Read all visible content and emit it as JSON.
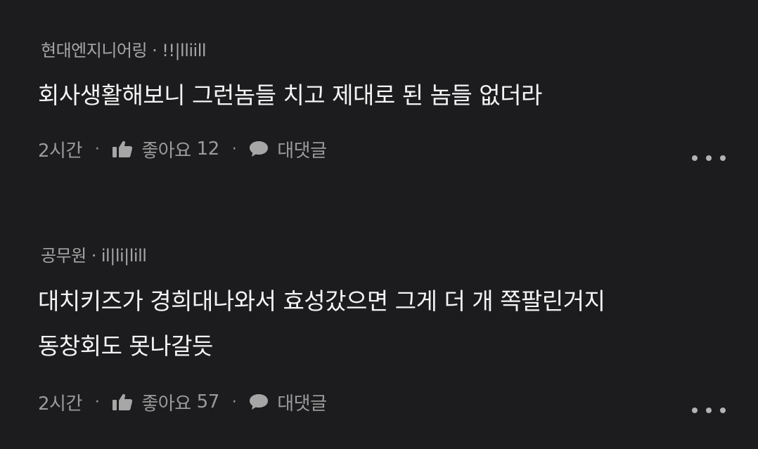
{
  "comments": [
    {
      "company": "현대엔지니어링",
      "separator": "·",
      "username": "!!|lliill",
      "text_lines": [
        "회사생활해보니 그런놈들 치고 제대로 된 놈들 없더라"
      ],
      "time": "2시간",
      "like_label": "좋아요",
      "like_count": "12",
      "reply_label": "대댓글"
    },
    {
      "company": "공무원",
      "separator": "·",
      "username": "il|li|lill",
      "text_lines": [
        "대치키즈가 경희대나와서 효성갔으면 그게 더 개 쪽팔린거지",
        "동창회도 못나갈듯"
      ],
      "time": "2시간",
      "like_label": "좋아요",
      "like_count": "57",
      "reply_label": "대댓글"
    }
  ],
  "icons": {
    "like": "thumbs-up-icon",
    "reply": "speech-bubble-icon",
    "more": "more-options-icon"
  },
  "colors": {
    "background": "#1c1c1e",
    "text": "#f4f4f4",
    "muted": "#a6a6a6"
  }
}
